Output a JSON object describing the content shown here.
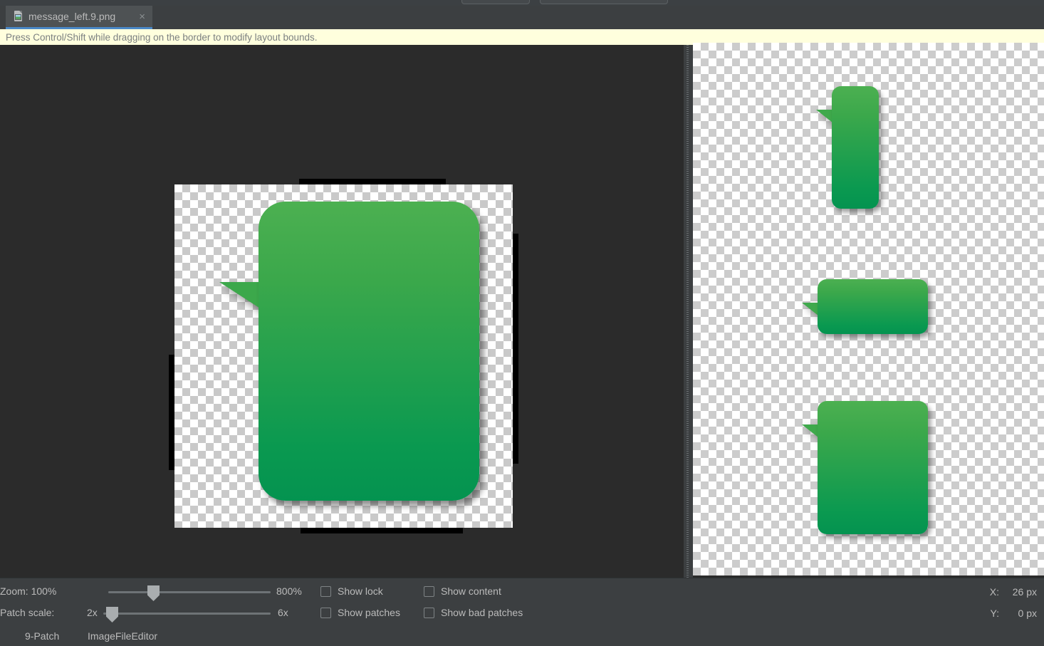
{
  "toolbar": {
    "partial_fields": [
      "",
      ""
    ]
  },
  "tab": {
    "label": "message_left.9.png",
    "close_glyph": "×",
    "icon": "image-file-icon",
    "active_underline_color": "#4a88c7"
  },
  "banner": {
    "text": "Press Control/Shift while dragging on the border to modify layout bounds.",
    "background": "#ffffdd"
  },
  "editor": {
    "image_name": "message_left.9.png",
    "checkerboard_color": "#c9c9c9",
    "bubble_gradient_top": "#4cb051",
    "bubble_gradient_bottom": "#049350",
    "patch_marker_color": "#000000"
  },
  "preview": {
    "checkerboard_color": "#cccccc",
    "items": [
      {
        "name": "preview-bubble-tall"
      },
      {
        "name": "preview-bubble-wide"
      },
      {
        "name": "preview-bubble-large"
      }
    ]
  },
  "controls": {
    "zoom": {
      "label": "Zoom: 100%",
      "value_percent": 100,
      "max_label": "800%",
      "slider_position_percent": 26
    },
    "patch_scale": {
      "label": "Patch scale:",
      "min_label": "2x",
      "max_label": "6x",
      "slider_position_percent": 2
    },
    "checkboxes": [
      {
        "label": "Show lock",
        "checked": false
      },
      {
        "label": "Show content",
        "checked": false
      },
      {
        "label": "Show patches",
        "checked": false
      },
      {
        "label": "Show bad patches",
        "checked": false
      }
    ]
  },
  "coords": {
    "x_key": "X:",
    "x_value": "26 px",
    "y_key": "Y:",
    "y_value": "0 px"
  },
  "status_bar": {
    "items": [
      "9-Patch",
      "ImageFileEditor"
    ]
  }
}
